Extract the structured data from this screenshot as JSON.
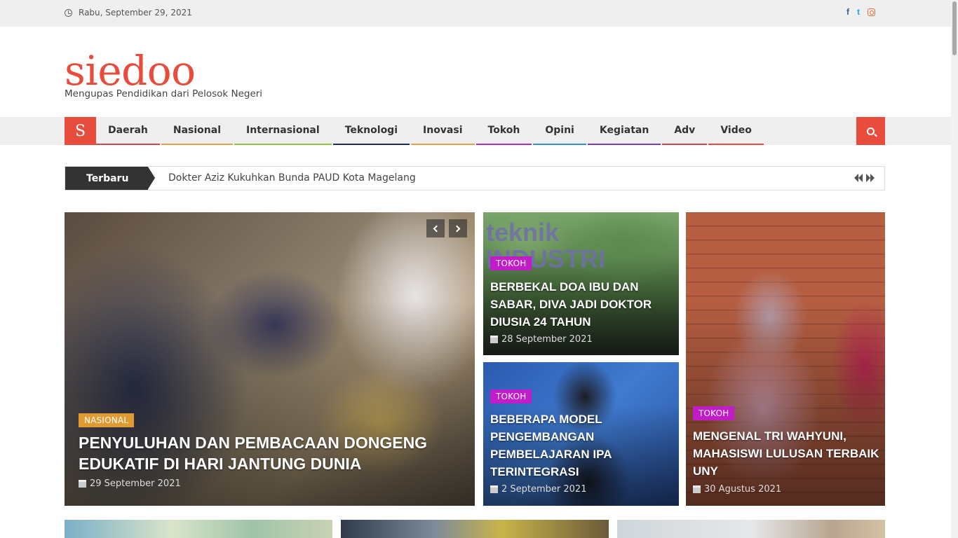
{
  "topbar": {
    "date": "Rabu, September 29, 2021",
    "social": [
      {
        "icon": "facebook-icon",
        "glyph": "f"
      },
      {
        "icon": "twitter-icon",
        "glyph": "t"
      },
      {
        "icon": "instagram-icon",
        "glyph": ""
      }
    ]
  },
  "header": {
    "logo": "siedoo",
    "tagline": "Mengupas Pendidikan dari Pelosok Negeri"
  },
  "nav": {
    "home_label": "S",
    "items": [
      {
        "label": "Daerah",
        "color": "#d0474c"
      },
      {
        "label": "Nasional",
        "color": "#e3a34a"
      },
      {
        "label": "Internasional",
        "color": "#8dc63f"
      },
      {
        "label": "Teknologi",
        "color": "#1d2a5c"
      },
      {
        "label": "Inovasi",
        "color": "#e3a34a"
      },
      {
        "label": "Tokoh",
        "color": "#a632b5"
      },
      {
        "label": "Opini",
        "color": "#3a8cc4"
      },
      {
        "label": "Kegiatan",
        "color": "#7a3cb5"
      },
      {
        "label": "Adv",
        "color": "#d0474c"
      },
      {
        "label": "Video",
        "color": "#e74c3c"
      }
    ]
  },
  "ticker": {
    "label": "Terbaru",
    "headline": "Dokter Aziz Kukuhkan Bunda PAUD Kota Magelang"
  },
  "featured": [
    {
      "category": "NASIONAL",
      "category_color": "#e09a32",
      "title": "PENYULUHAN DAN PEMBACAAN DONGENG EDUKATIF DI HARI JANTUNG DUNIA",
      "date": "29 September 2021"
    },
    {
      "category": "TOKOH",
      "category_color": "#c21bc9",
      "title": "BERBEKAL DOA IBU DAN SABAR, DIVA JADI DOKTOR DIUSIA 24 TAHUN",
      "date": "28 September 2021"
    },
    {
      "category": "TOKOH",
      "category_color": "#c21bc9",
      "title": "BEBERAPA MODEL PENGEMBANGAN PEMBELAJARAN IPA TERINTEGRASI",
      "date": "2 September 2021"
    },
    {
      "category": "TOKOH",
      "category_color": "#c21bc9",
      "title": "MENGENAL TRI WAHYUNI, MAHASISWI LULUSAN TERBAIK UNY",
      "date": "30 Agustus 2021"
    }
  ],
  "card2_image_text": "teknik INDUSTRI",
  "accent": "#e74c3c"
}
